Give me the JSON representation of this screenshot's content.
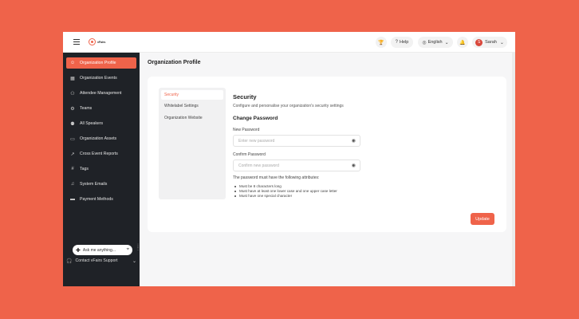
{
  "topbar": {
    "logo_text": "vFairs",
    "help_label": "Help",
    "language_label": "English",
    "user_name": "Sarah",
    "user_initial": "S"
  },
  "sidebar": {
    "items": [
      {
        "label": "Organization Profile",
        "icon": "user-icon"
      },
      {
        "label": "Organization Events",
        "icon": "calendar-icon"
      },
      {
        "label": "Attendee Management",
        "icon": "users-icon"
      },
      {
        "label": "Teams",
        "icon": "teams-icon"
      },
      {
        "label": "All Speakers",
        "icon": "speakers-icon"
      },
      {
        "label": "Organization Assets",
        "icon": "folder-icon"
      },
      {
        "label": "Cross Event Reports",
        "icon": "chart-icon"
      },
      {
        "label": "Tags",
        "icon": "hash-icon"
      },
      {
        "label": "System Emails",
        "icon": "bell-icon"
      },
      {
        "label": "Payment Methods",
        "icon": "card-icon"
      }
    ],
    "ask_placeholder": "Ask me anything...",
    "support_label": "Contact vFairs Support"
  },
  "main": {
    "page_title": "Organization Profile",
    "subnav": [
      "Security",
      "Whitelabel Settings",
      "Organization Website"
    ],
    "section_title": "Security",
    "section_desc": "Configure and personalise your organization's security settings",
    "change_password_title": "Change Password",
    "new_password_label": "New Password",
    "new_password_placeholder": "Enter new password",
    "confirm_password_label": "Confirm Password",
    "confirm_password_placeholder": "Confirm new password",
    "rules_title": "The password must have the following attributes:",
    "rules": [
      "Must be 8 characters long",
      "Must have at least one lower case and one upper case letter",
      "Must have one special character"
    ],
    "update_label": "Update"
  },
  "colors": {
    "accent": "#ef634a",
    "sidebar_bg": "#1f2227"
  }
}
